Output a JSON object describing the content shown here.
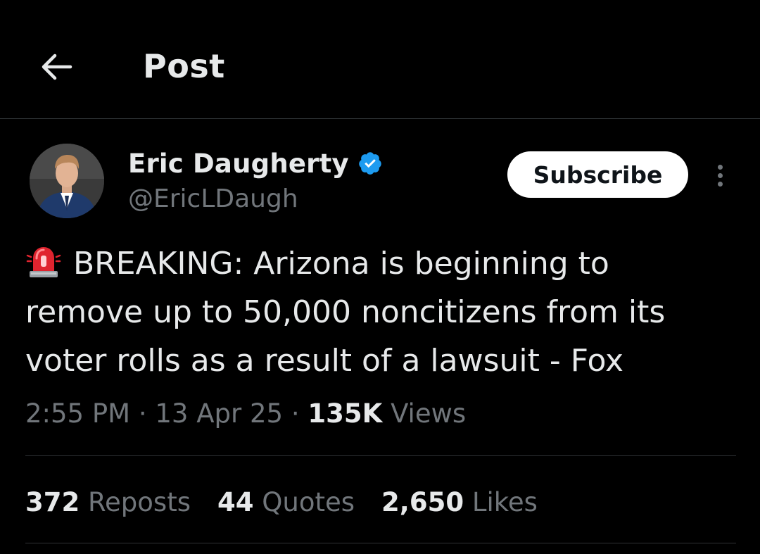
{
  "header": {
    "title": "Post",
    "back_icon": "arrow-left-icon"
  },
  "author": {
    "name": "Eric Daugherty",
    "handle": "@EricLDaugh",
    "verified": true,
    "verified_color": "#1d9bf0"
  },
  "actions": {
    "subscribe_label": "Subscribe",
    "more_icon": "more-vertical-icon"
  },
  "post": {
    "emoji_icon": "rotating-light-icon",
    "text": "BREAKING: Arizona is beginning to remove up to 50,000 noncitizens from its voter rolls as a result of a lawsuit - Fox",
    "time": "2:55 PM",
    "date": "13 Apr 25",
    "views_count": "135K",
    "views_label": "Views",
    "separator": "·"
  },
  "stats": {
    "reposts_count": "372",
    "reposts_label": "Reposts",
    "quotes_count": "44",
    "quotes_label": "Quotes",
    "likes_count": "2,650",
    "likes_label": "Likes"
  },
  "colors": {
    "background": "#000000",
    "text_primary": "#e7e9ea",
    "text_secondary": "#71767b",
    "divider": "#2f3336",
    "button_bg": "#ffffff"
  }
}
